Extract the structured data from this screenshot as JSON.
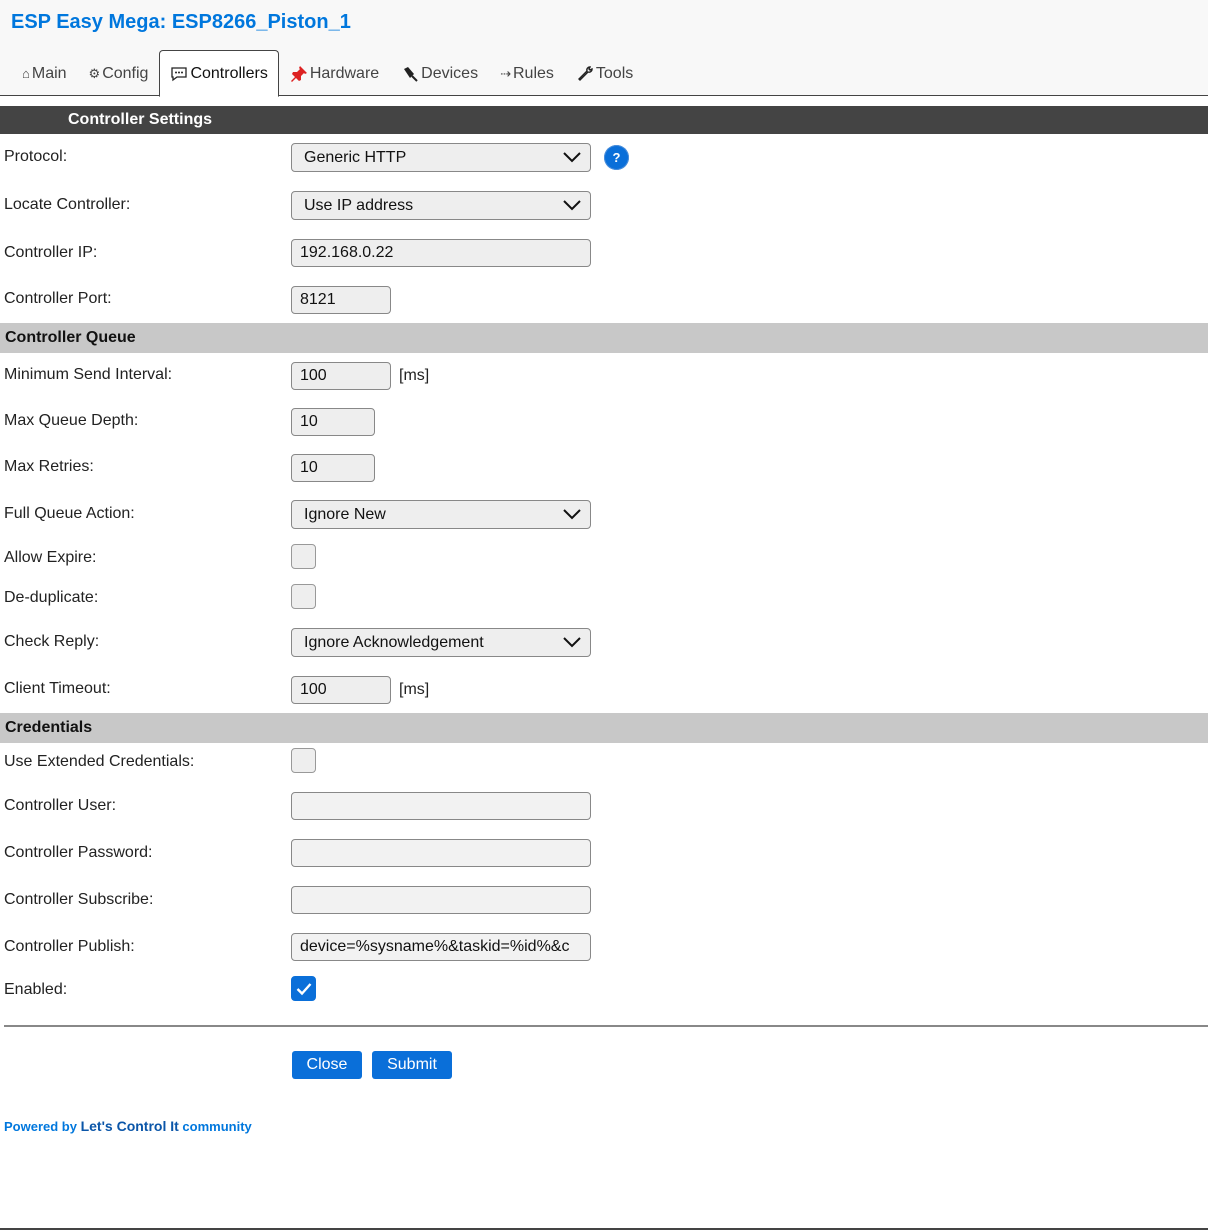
{
  "app": {
    "title": "ESP Easy Mega: ESP8266_Piston_1"
  },
  "tabs": [
    {
      "label": "Main",
      "icon": "home-icon"
    },
    {
      "label": "Config",
      "icon": "gear-icon"
    },
    {
      "label": "Controllers",
      "icon": "speech-bubble-icon",
      "active": true
    },
    {
      "label": "Hardware",
      "icon": "pushpin-icon"
    },
    {
      "label": "Devices",
      "icon": "plug-icon"
    },
    {
      "label": "Rules",
      "icon": "arrow-right-icon"
    },
    {
      "label": "Tools",
      "icon": "wrench-icon"
    }
  ],
  "sections": {
    "settings": "Controller Settings",
    "queue": "Controller Queue",
    "credentials": "Credentials"
  },
  "fields": {
    "protocol": {
      "label": "Protocol:",
      "value": "Generic HTTP",
      "help": "?"
    },
    "locate": {
      "label": "Locate Controller:",
      "value": "Use IP address"
    },
    "ip": {
      "label": "Controller IP:",
      "value": "192.168.0.22"
    },
    "port": {
      "label": "Controller Port:",
      "value": "8121"
    },
    "min_interval": {
      "label": "Minimum Send Interval:",
      "value": "100",
      "unit": "[ms]"
    },
    "max_queue": {
      "label": "Max Queue Depth:",
      "value": "10"
    },
    "max_retries": {
      "label": "Max Retries:",
      "value": "10"
    },
    "full_queue": {
      "label": "Full Queue Action:",
      "value": "Ignore New"
    },
    "allow_expire": {
      "label": "Allow Expire:",
      "checked": false
    },
    "dedup": {
      "label": "De-duplicate:",
      "checked": false
    },
    "check_reply": {
      "label": "Check Reply:",
      "value": "Ignore Acknowledgement"
    },
    "client_timeout": {
      "label": "Client Timeout:",
      "value": "100",
      "unit": "[ms]"
    },
    "ext_cred": {
      "label": "Use Extended Credentials:",
      "checked": false
    },
    "user": {
      "label": "Controller User:",
      "value": ""
    },
    "password": {
      "label": "Controller Password:",
      "value": ""
    },
    "subscribe": {
      "label": "Controller Subscribe:",
      "value": ""
    },
    "publish": {
      "label": "Controller Publish:",
      "value": "device=%sysname%&taskid=%id%&c"
    },
    "enabled": {
      "label": "Enabled:",
      "checked": true
    }
  },
  "buttons": {
    "close": "Close",
    "submit": "Submit"
  },
  "footer": {
    "prefix": "Powered by ",
    "brand": "Let's Control It",
    "suffix": " community"
  },
  "colors": {
    "accent": "#0a6fd9",
    "title": "#0077dd",
    "header_bar": "#444444",
    "subheader": "#c8c8c8"
  }
}
